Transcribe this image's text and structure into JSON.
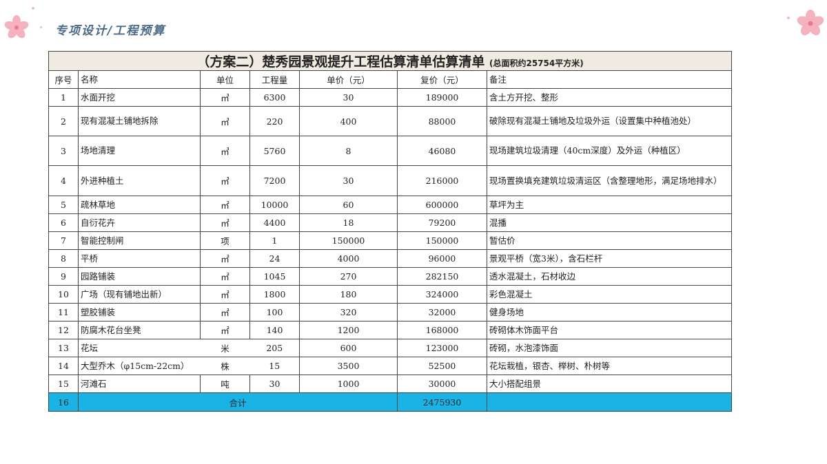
{
  "header": {
    "title": "专项设计/工程预算"
  },
  "table": {
    "title": "（方案二）楚秀园景观提升工程估算清单估算清单",
    "subtitle": "(总面积约25754平方米)",
    "columns": [
      "序号",
      "名称",
      "单位",
      "工程量",
      "单价（元）",
      "复价（元）",
      "备注"
    ],
    "rows": [
      [
        "1",
        "水面开挖",
        "㎥",
        "6300",
        "30",
        "189000",
        "含土方开挖、整形"
      ],
      [
        "2",
        "现有混凝土铺地拆除",
        "㎥",
        "220",
        "400",
        "88000",
        "破除现有混凝土铺地及垃圾外运（设置集中种植池处）"
      ],
      [
        "3",
        "场地清理",
        "㎥",
        "5760",
        "8",
        "46080",
        "现场建筑垃圾清理（40cm深度）及外运（种植区）"
      ],
      [
        "4",
        "外进种植土",
        "㎥",
        "7200",
        "30",
        "216000",
        "现场置换填充建筑垃圾清运区（含整理地形，满足场地排水）"
      ],
      [
        "5",
        "疏林草地",
        "㎡",
        "10000",
        "60",
        "600000",
        "草坪为主"
      ],
      [
        "6",
        "自衍花卉",
        "㎡",
        "4400",
        "18",
        "79200",
        "混播"
      ],
      [
        "7",
        "智能控制闸",
        "项",
        "1",
        "150000",
        "150000",
        "暂估价"
      ],
      [
        "8",
        "平桥",
        "㎡",
        "24",
        "4000",
        "96000",
        "景观平桥（宽3米），含石栏杆"
      ],
      [
        "9",
        "园路铺装",
        "㎡",
        "1045",
        "270",
        "282150",
        "透水混凝土，石材收边"
      ],
      [
        "10",
        "广场（现有铺地出新）",
        "㎡",
        "1800",
        "180",
        "324000",
        "彩色混凝土"
      ],
      [
        "11",
        "塑胶铺装",
        "㎡",
        "100",
        "320",
        "32000",
        "健身场地"
      ],
      [
        "12",
        "防腐木花台坐凳",
        "㎡",
        "140",
        "1200",
        "168000",
        "砖砌体木饰面平台"
      ],
      [
        "13",
        "花坛",
        "米",
        "205",
        "600",
        "123000",
        "砖砌，水泡漆饰面"
      ],
      [
        "14",
        "大型乔木（φ15cm-22cm）",
        "株",
        "15",
        "3500",
        "52500",
        "花坛栽植，银杏、榉树、朴树等"
      ],
      [
        "15",
        "河滩石",
        "吨",
        "30",
        "1000",
        "30000",
        "大小搭配组景"
      ]
    ],
    "total": {
      "index": "16",
      "label": "合计",
      "value": "2475930",
      "note": ""
    }
  },
  "colors": {
    "total_bg": "#19b3e6",
    "title_bg": "#efebe0",
    "header_text": "#4a6a8a"
  },
  "icons": [
    "cherry-blossom-icon"
  ]
}
